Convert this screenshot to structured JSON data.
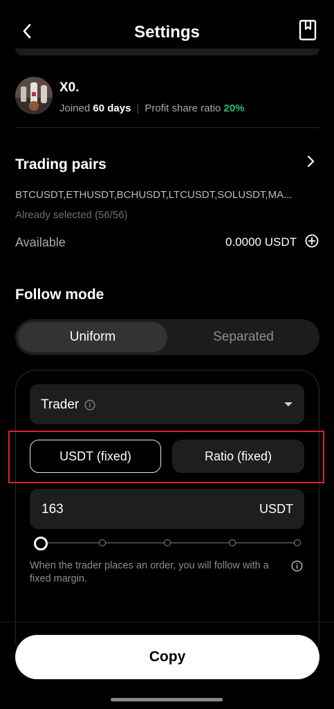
{
  "header": {
    "title": "Settings"
  },
  "user": {
    "name": "X0.",
    "joined_label": "Joined",
    "joined_value": "60 days",
    "separator": "|",
    "profit_label": "Profit share ratio",
    "profit_value": "20%"
  },
  "trading_pairs": {
    "title": "Trading pairs",
    "list": "BTCUSDT,ETHUSDT,BCHUSDT,LTCUSDT,SOLUSDT,MA...",
    "selected": "Already selected (56/56)"
  },
  "available": {
    "label": "Available",
    "value": "0.0000 USDT"
  },
  "follow_mode": {
    "title": "Follow mode",
    "options": [
      "Uniform",
      "Separated"
    ],
    "selected": "Uniform"
  },
  "role_dropdown": {
    "value": "Trader"
  },
  "margin_type": {
    "options": [
      "USDT (fixed)",
      "Ratio (fixed)"
    ],
    "selected": "USDT (fixed)"
  },
  "amount": {
    "value": "163",
    "unit": "USDT"
  },
  "slider": {
    "level": 0,
    "steps": 5
  },
  "helper_text": "When the trader places an order, you will follow with a fixed margin.",
  "footer": {
    "copy_label": "Copy"
  },
  "colors": {
    "accent_green": "#2ebd6b",
    "highlight_red": "#e0202a",
    "background": "#000000"
  }
}
